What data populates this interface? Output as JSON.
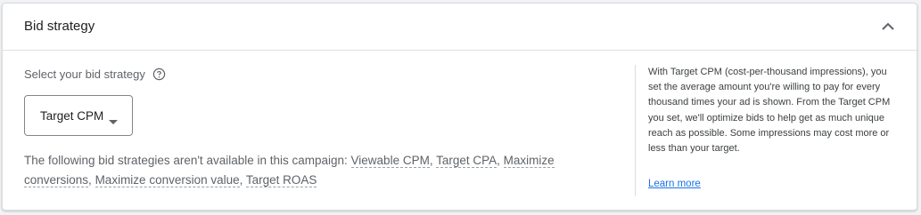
{
  "section": {
    "title": "Bid strategy",
    "collapse_icon": "chevron-up-icon"
  },
  "bid": {
    "select_label": "Select your bid strategy",
    "help_icon": "help-circle-icon",
    "selected": "Target CPM",
    "dropdown_icon": "arrow-drop-down-icon",
    "unavailable_prefix": "The following bid strategies aren't available in this campaign: ",
    "unavailable": [
      "Viewable CPM",
      "Target CPA",
      "Maximize conversions",
      "Maximize conversion value",
      "Target ROAS"
    ]
  },
  "info": {
    "description": "With Target CPM (cost-per-thousand impressions), you set the average amount you're willing to pay for every thousand times your ad is shown. From the Target CPM you set, we'll optimize bids to help get as much unique reach as possible. Some impressions may cost more or less than your target.",
    "learn_more": "Learn more"
  },
  "colors": {
    "link": "#1a73e8",
    "border": "#dadce0",
    "text": "#3c4043"
  }
}
